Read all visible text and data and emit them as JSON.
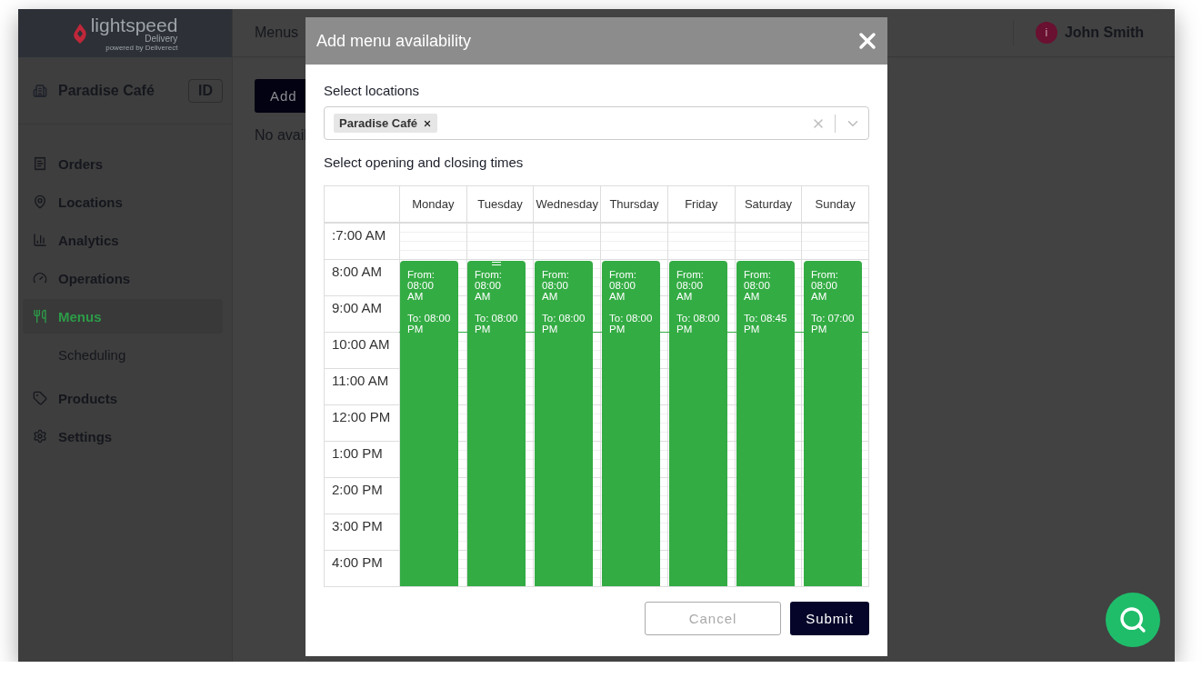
{
  "brand": {
    "name": "lightspeed",
    "product": "Delivery",
    "tagline": "powered by Deliverect"
  },
  "header": {
    "title": "Menus",
    "user": {
      "initial": "i",
      "name": "John Smith"
    }
  },
  "location": {
    "name": "Paradise Café",
    "badge": "ID"
  },
  "nav": [
    {
      "label": "Orders",
      "selected": false
    },
    {
      "label": "Locations",
      "selected": false
    },
    {
      "label": "Analytics",
      "selected": false
    },
    {
      "label": "Operations",
      "selected": false
    },
    {
      "label": "Menus",
      "selected": true,
      "children": [
        {
          "label": "Scheduling",
          "selected": false
        }
      ]
    },
    {
      "label": "Products",
      "selected": false
    },
    {
      "label": "Settings",
      "selected": false
    }
  ],
  "page": {
    "add_button": "Add",
    "empty_text": "No avail"
  },
  "modal": {
    "title": "Add menu availability",
    "locations_label": "Select locations",
    "locations": [
      {
        "label": "Paradise Café"
      }
    ],
    "times_label": "Select opening and closing times",
    "calendar": {
      "times": [
        ":7:00 AM",
        "8:00 AM",
        "9:00 AM",
        "10:00 AM",
        "11:00 AM",
        "12:00 PM",
        "1:00 PM",
        "2:00 PM",
        "3:00 PM",
        "4:00 PM"
      ],
      "days": [
        {
          "name": "Monday",
          "hovered": false,
          "event": {
            "from_label": "From:",
            "from": "08:00 AM",
            "to_label": "To:",
            "to": "08:00 PM"
          }
        },
        {
          "name": "Tuesday",
          "hovered": true,
          "event": {
            "from_label": "From:",
            "from": "08:00 AM",
            "to_label": "To:",
            "to": "08:00 PM"
          }
        },
        {
          "name": "Wednesday",
          "hovered": false,
          "event": {
            "from_label": "From:",
            "from": "08:00 AM",
            "to_label": "To:",
            "to": "08:00 PM"
          }
        },
        {
          "name": "Thursday",
          "hovered": false,
          "event": {
            "from_label": "From:",
            "from": "08:00 AM",
            "to_label": "To:",
            "to": "08:00 PM"
          }
        },
        {
          "name": "Friday",
          "hovered": false,
          "event": {
            "from_label": "From:",
            "from": "08:00 AM",
            "to_label": "To:",
            "to": "08:00 PM"
          }
        },
        {
          "name": "Saturday",
          "hovered": false,
          "event": {
            "from_label": "From:",
            "from": "08:00 AM",
            "to_label": "To:",
            "to": "08:45 PM"
          }
        },
        {
          "name": "Sunday",
          "hovered": false,
          "event": {
            "from_label": "From:",
            "from": "08:00 AM",
            "to_label": "To:",
            "to": "07:00 PM"
          }
        }
      ]
    },
    "cancel": "Cancel",
    "submit": "Submit"
  }
}
